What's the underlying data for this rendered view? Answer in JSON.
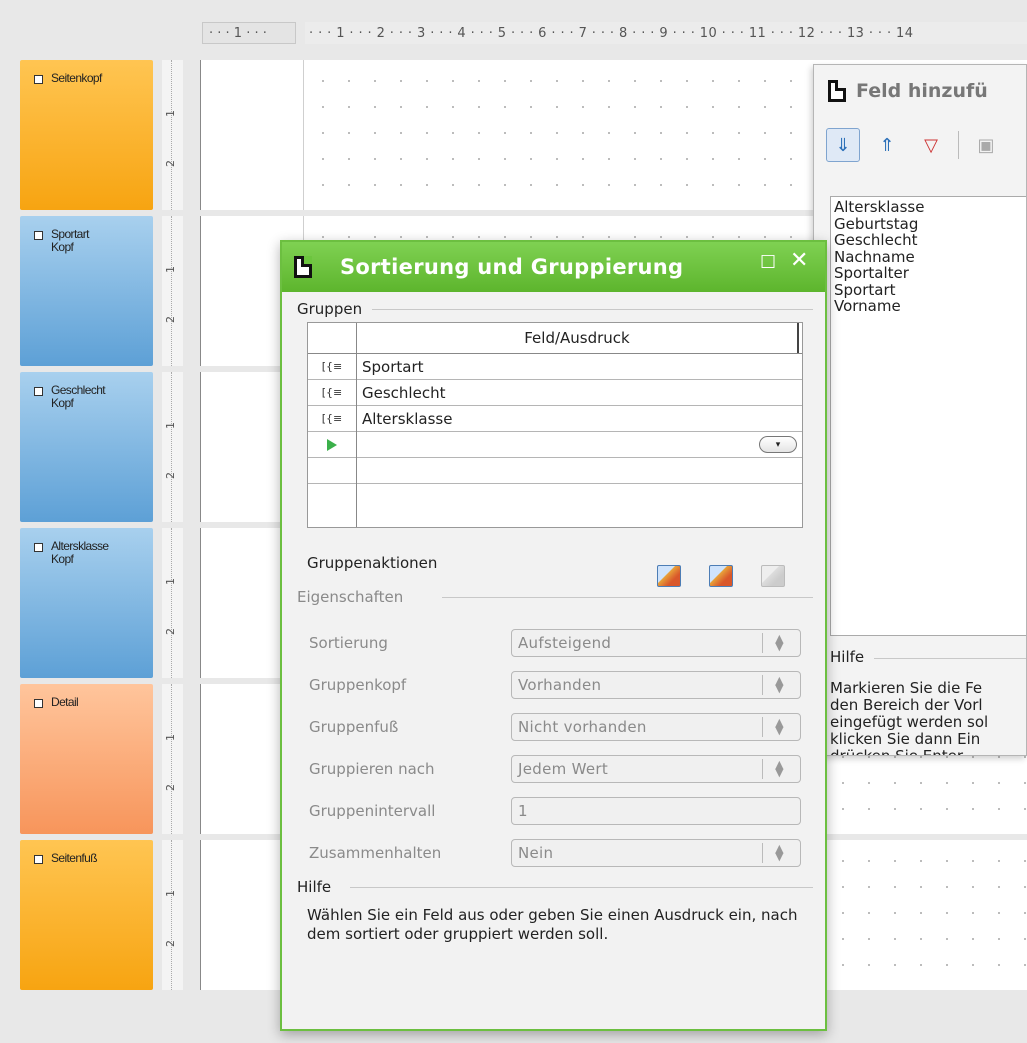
{
  "editor": {
    "ruler_left": "· · · 1 · · ·",
    "ruler_main": "· · · 1 · · · 2 · · · 3 · · · 4 · · · 5 · · · 6 · · · 7 · · · 8 · · · 9 · · · 10 · · · 11 · · · 12 · · · 13 · · · 14",
    "sections": [
      {
        "label": "Seitenkopf"
      },
      {
        "label": "Sportart Kopf"
      },
      {
        "label": "Geschlecht Kopf"
      },
      {
        "label": "Altersklasse Kopf"
      },
      {
        "label": "Detail"
      },
      {
        "label": "Seitenfuß"
      }
    ],
    "ruler_marks": {
      "one": "1",
      "two": "2"
    }
  },
  "field_panel": {
    "title": "Feld hinzufü",
    "fields": [
      "Altersklasse",
      "Geburtstag",
      "Geschlecht",
      "Nachname",
      "Sportalter",
      "Sportart",
      "Vorname"
    ],
    "help_title": "Hilfe",
    "help_lines": [
      "Markieren Sie die Fe",
      "den Bereich der Vorl",
      "eingefügt werden sol",
      "klicken Sie dann Ein",
      "drücken Sie Enter."
    ]
  },
  "dialog": {
    "title": "Sortierung und Gruppierung",
    "groups_label": "Gruppen",
    "column_header": "Feld/Ausdruck",
    "groups": [
      {
        "row_icon": "[{≡",
        "value": "Sportart"
      },
      {
        "row_icon": "[{≡",
        "value": "Geschlecht"
      },
      {
        "row_icon": "[{≡",
        "value": "Altersklasse"
      }
    ],
    "group_actions_label": "Gruppenaktionen",
    "properties_label": "Eigenschaften",
    "properties": {
      "sort": {
        "label": "Sortierung",
        "value": "Aufsteigend"
      },
      "header": {
        "label": "Gruppenkopf",
        "value": "Vorhanden"
      },
      "footer": {
        "label": "Gruppenfuß",
        "value": "Nicht vorhanden"
      },
      "groupby": {
        "label": "Gruppieren nach",
        "value": "Jedem Wert"
      },
      "interval": {
        "label": "Gruppenintervall",
        "value": "1"
      },
      "keep": {
        "label": "Zusammenhalten",
        "value": "Nein"
      }
    },
    "help_label": "Hilfe",
    "help_text": "Wählen Sie ein Feld aus oder geben Sie einen Ausdruck ein, nach dem sortiert oder gruppiert werden soll."
  },
  "colors": {
    "dialog_accent": "#6cbf40",
    "page_header": "#f7a411",
    "group_header": "#5da0d6",
    "detail": "#f7955b"
  }
}
